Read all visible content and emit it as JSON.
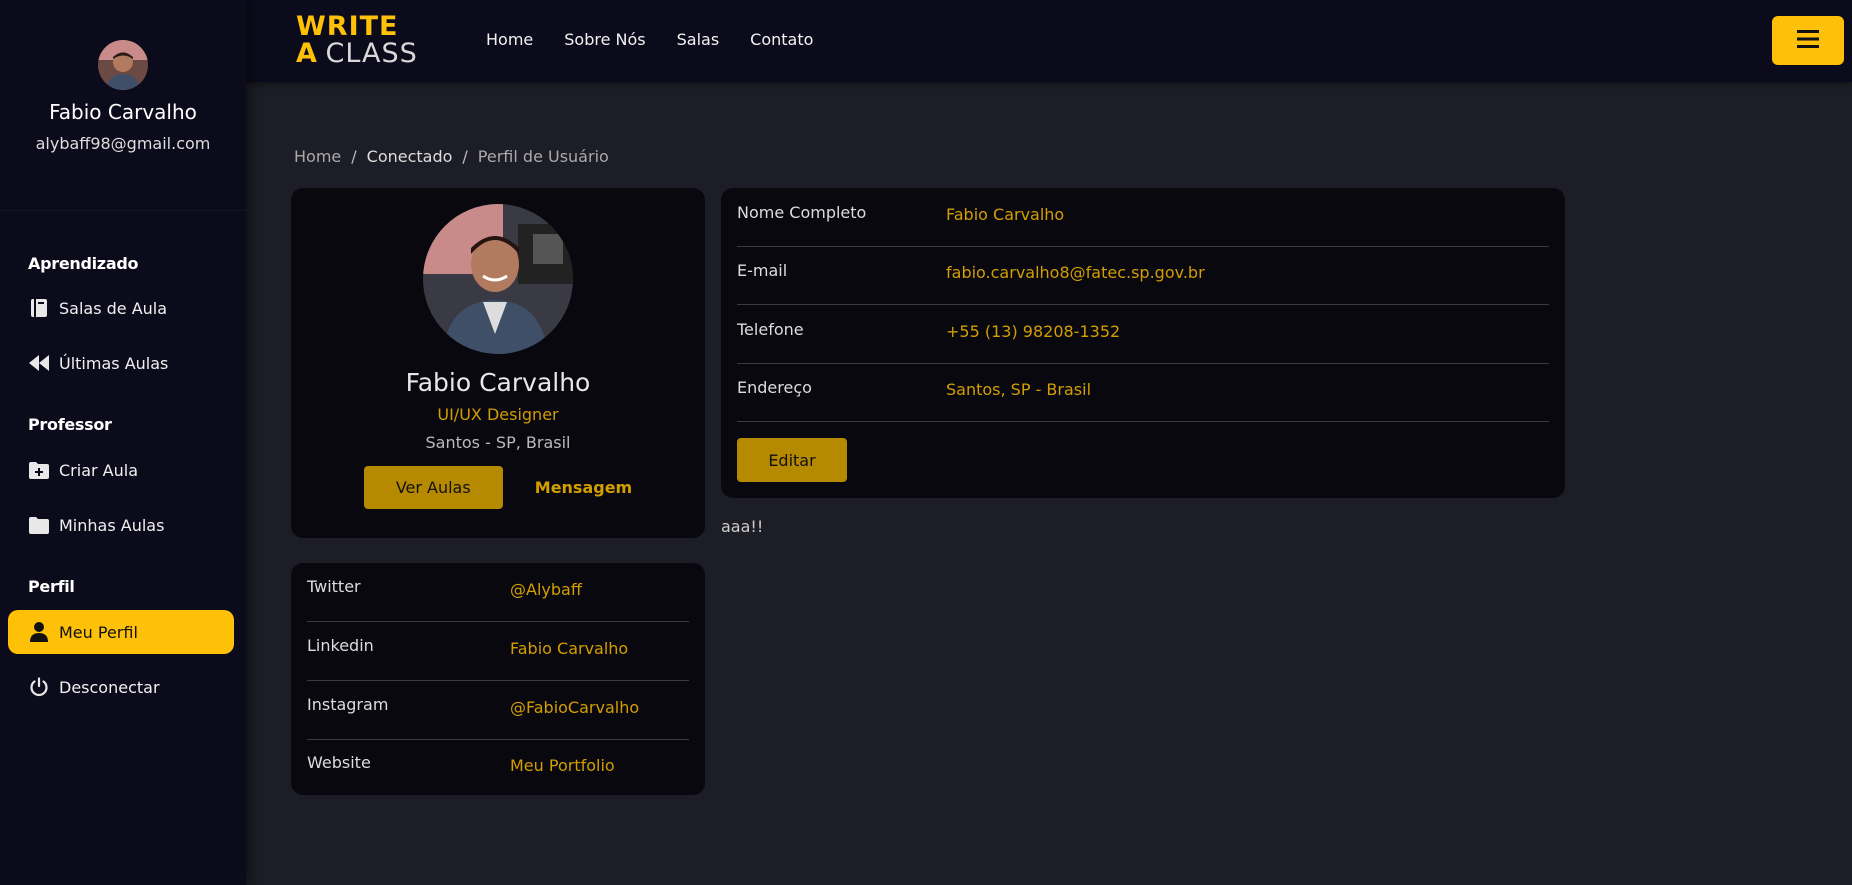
{
  "sidebar": {
    "user_name": "Fabio Carvalho",
    "user_email": "alybaff98@gmail.com",
    "sections": {
      "aprendizado": "Aprendizado",
      "professor": "Professor",
      "perfil": "Perfil"
    },
    "items": [
      {
        "label": "Salas de Aula",
        "icon": "book-icon"
      },
      {
        "label": "Últimas Aulas",
        "icon": "rewind-icon"
      },
      {
        "label": "Criar Aula",
        "icon": "folder-plus-icon"
      },
      {
        "label": "Minhas Aulas",
        "icon": "folder-icon"
      },
      {
        "label": "Meu Perfil",
        "icon": "user-icon",
        "active": true
      },
      {
        "label": "Desconectar",
        "icon": "power-icon"
      }
    ]
  },
  "header": {
    "logo_line1": "WRITE",
    "logo_a": "A",
    "logo_class": "CLASS",
    "nav": [
      "Home",
      "Sobre Nós",
      "Salas",
      "Contato"
    ],
    "menu_icon": "hamburger-icon"
  },
  "breadcrumb": [
    "Home",
    "Conectado",
    "Perfil de Usuário"
  ],
  "profile": {
    "name": "Fabio Carvalho",
    "role": "UI/UX Designer",
    "location": "Santos - SP, Brasil",
    "btn_aulas": "Ver Aulas",
    "btn_mensagem": "Mensagem"
  },
  "details": [
    {
      "label": "Nome Completo",
      "value": "Fabio Carvalho"
    },
    {
      "label": "E-mail",
      "value": "fabio.carvalho8@fatec.sp.gov.br"
    },
    {
      "label": "Telefone",
      "value": "+55 (13) 98208-1352"
    },
    {
      "label": "Endereço",
      "value": "Santos, SP - Brasil"
    }
  ],
  "edit_label": "Editar",
  "note": "aaa!!",
  "social": [
    {
      "label": "Twitter",
      "value": "@Alybaff"
    },
    {
      "label": "Linkedin",
      "value": "Fabio Carvalho"
    },
    {
      "label": "Instagram",
      "value": "@FabioCarvalho"
    },
    {
      "label": "Website",
      "value": "Meu Portfolio"
    }
  ],
  "colors": {
    "accent": "#ffc107",
    "accent_dark": "#b58900",
    "link": "#d39e00",
    "bg": "#1d1d27",
    "panel": "#0c0b1c"
  }
}
